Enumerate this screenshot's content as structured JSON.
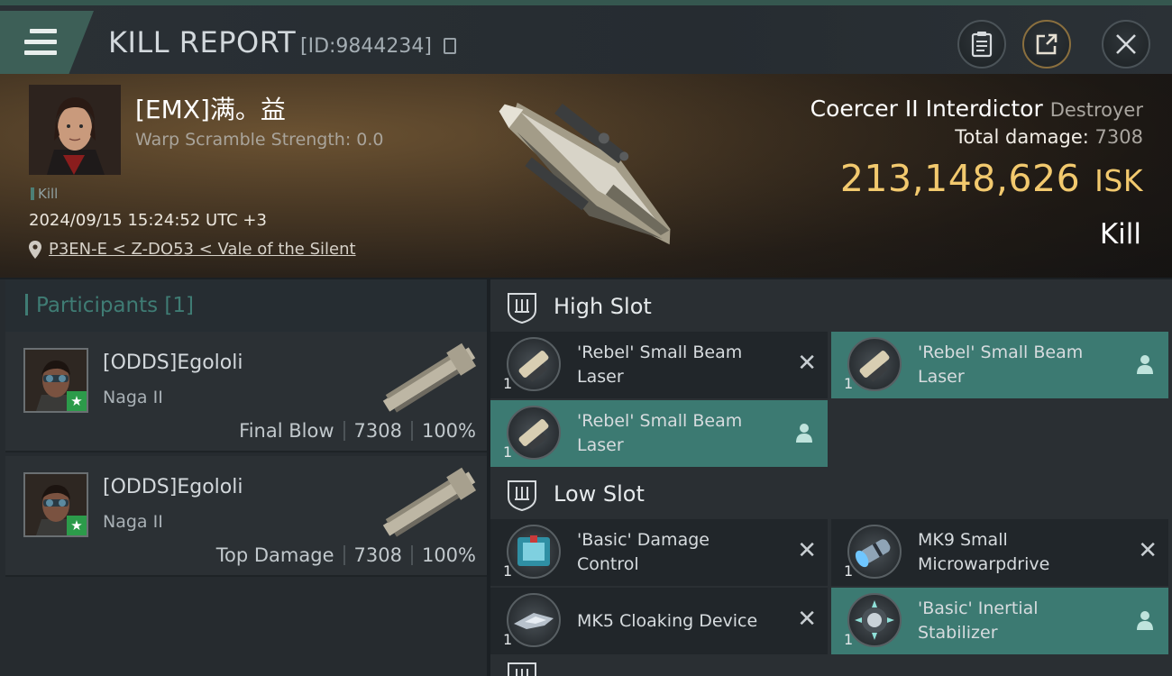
{
  "header": {
    "title": "KILL REPORT",
    "report_id": "[ID:9844234]"
  },
  "victim": {
    "name": "[EMX]满。益",
    "warp_scramble": "Warp Scramble Strength: 0.0",
    "tag": "Kill",
    "timestamp": "2024/09/15 15:24:52 UTC +3",
    "location": "P3EN-E < Z-DO53 < Vale of the Silent",
    "ship_name": "Coercer II Interdictor",
    "ship_class": "Destroyer",
    "total_damage_label": "Total damage:",
    "total_damage": "7308",
    "isk_value": "213,148,626",
    "isk_unit": "ISK",
    "result": "Kill"
  },
  "participants": {
    "title": "Participants [1]",
    "list": [
      {
        "name": "[ODDS]Egololi",
        "ship": "Naga II",
        "role": "Final Blow",
        "damage": "7308",
        "percent": "100%"
      },
      {
        "name": "[ODDS]Egololi",
        "ship": "Naga II",
        "role": "Top Damage",
        "damage": "7308",
        "percent": "100%"
      }
    ]
  },
  "slots": {
    "high": {
      "label": "High Slot",
      "modules": [
        {
          "name_line1": "'Rebel' Small Beam",
          "name_line2": "Laser",
          "qty": "1",
          "status": "destroyed"
        },
        {
          "name_line1": "'Rebel' Small Beam",
          "name_line2": "Laser",
          "qty": "1",
          "status": "dropped"
        },
        {
          "name_line1": "'Rebel' Small Beam",
          "name_line2": "Laser",
          "qty": "1",
          "status": "dropped"
        }
      ]
    },
    "low": {
      "label": "Low Slot",
      "modules": [
        {
          "name_line1": "'Basic' Damage",
          "name_line2": "Control",
          "qty": "1",
          "status": "destroyed"
        },
        {
          "name_line1": "MK9 Small",
          "name_line2": "Microwarpdrive",
          "qty": "1",
          "status": "destroyed"
        },
        {
          "name_line1": "MK5 Cloaking Device",
          "name_line2": "",
          "qty": "1",
          "status": "destroyed"
        },
        {
          "name_line1": "'Basic' Inertial",
          "name_line2": "Stabilizer",
          "qty": "1",
          "status": "dropped"
        }
      ]
    }
  },
  "colors": {
    "accent": "#3c7a72",
    "isk": "#f2c96e",
    "header_teal": "#3d5f57"
  }
}
